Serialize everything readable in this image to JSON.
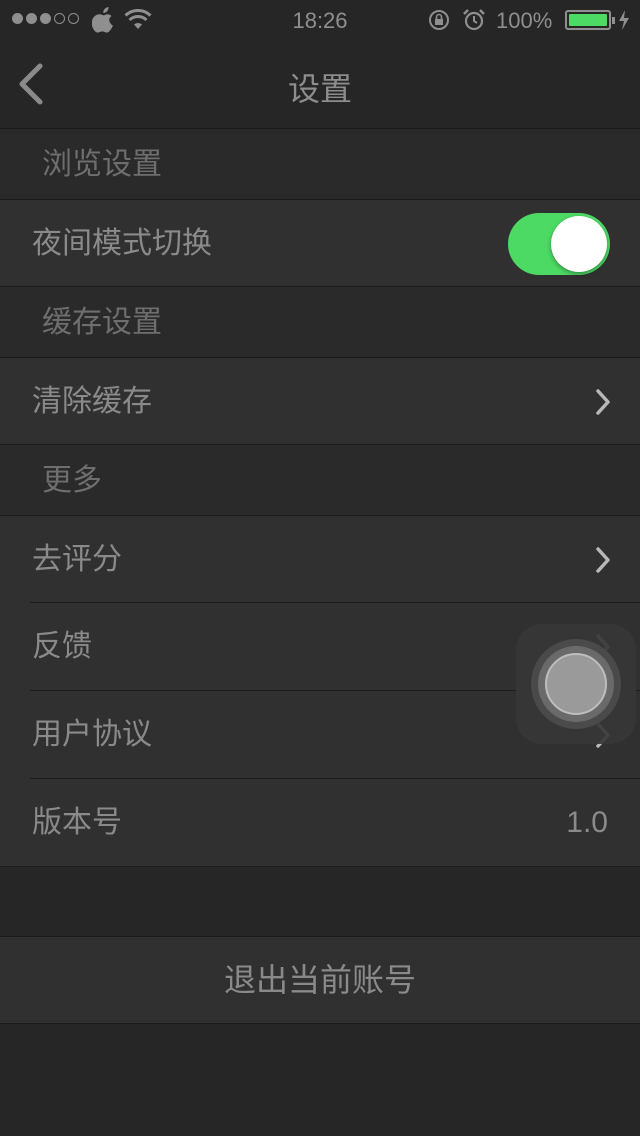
{
  "status_bar": {
    "time": "18:26",
    "battery_percent": "100%",
    "signal_bars_filled": 3,
    "signal_bars_total": 5,
    "battery_color": "#4cd964"
  },
  "nav": {
    "title": "设置",
    "back_icon": "chevron-left-icon"
  },
  "sections": {
    "browse": {
      "header": "浏览设置",
      "night_mode_label": "夜间模式切换",
      "night_mode_on": true,
      "toggle_color": "#4cd964"
    },
    "cache": {
      "header": "缓存设置",
      "clear_cache_label": "清除缓存"
    },
    "more": {
      "header": "更多",
      "rate_label": "去评分",
      "feedback_label": "反馈",
      "agreement_label": "用户协议",
      "version_label": "版本号",
      "version_value": "1.0"
    }
  },
  "logout_label": "退出当前账号"
}
